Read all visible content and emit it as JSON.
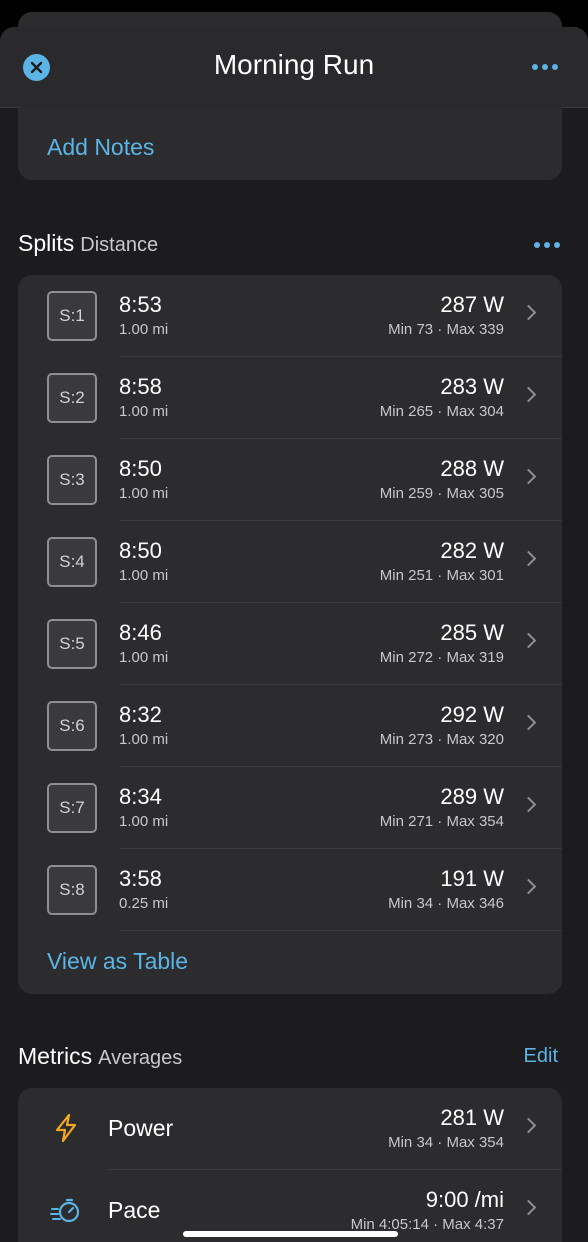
{
  "header": {
    "title": "Morning Run"
  },
  "notes": {
    "add_label": "Add Notes"
  },
  "splits": {
    "title": "Splits",
    "subtitle": "Distance",
    "rows": [
      {
        "badge": "S:1",
        "time": "8:53",
        "distance": "1.00 mi",
        "power": "287 W",
        "range": "Min 73 · Max 339"
      },
      {
        "badge": "S:2",
        "time": "8:58",
        "distance": "1.00 mi",
        "power": "283 W",
        "range": "Min 265 · Max 304"
      },
      {
        "badge": "S:3",
        "time": "8:50",
        "distance": "1.00 mi",
        "power": "288 W",
        "range": "Min 259 · Max 305"
      },
      {
        "badge": "S:4",
        "time": "8:50",
        "distance": "1.00 mi",
        "power": "282 W",
        "range": "Min 251 · Max 301"
      },
      {
        "badge": "S:5",
        "time": "8:46",
        "distance": "1.00 mi",
        "power": "285 W",
        "range": "Min 272 · Max 319"
      },
      {
        "badge": "S:6",
        "time": "8:32",
        "distance": "1.00 mi",
        "power": "292 W",
        "range": "Min 273 · Max 320"
      },
      {
        "badge": "S:7",
        "time": "8:34",
        "distance": "1.00 mi",
        "power": "289 W",
        "range": "Min 271 · Max 354"
      },
      {
        "badge": "S:8",
        "time": "3:58",
        "distance": "0.25 mi",
        "power": "191 W",
        "range": "Min 34 · Max 346"
      }
    ],
    "view_table_label": "View as Table"
  },
  "metrics": {
    "title": "Metrics",
    "subtitle": "Averages",
    "edit_label": "Edit",
    "rows": [
      {
        "icon": "lightning-bolt-icon",
        "name": "Power",
        "value": "281 W",
        "range": "Min 34 · Max 354"
      },
      {
        "icon": "pace-stopwatch-icon",
        "name": "Pace",
        "value": "9:00 /mi",
        "range": "Min 4:05:14 · Max 4:37"
      }
    ]
  },
  "colors": {
    "accent": "#5ab4e5",
    "power_icon": "#f5a623",
    "background": "#1c1c1e",
    "card": "#2c2c2e"
  }
}
